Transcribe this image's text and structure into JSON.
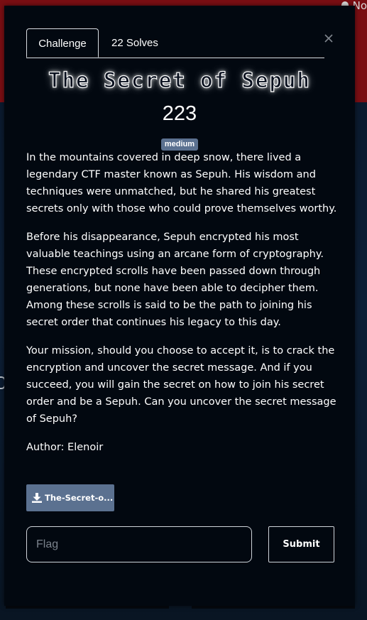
{
  "background": {
    "notification_label": "No"
  },
  "modal": {
    "tabs": [
      {
        "label": "Challenge",
        "active": true
      },
      {
        "label": "22 Solves",
        "active": false
      }
    ],
    "close_icon": "close-icon",
    "title": "The Secret of Sepuh",
    "points": "223",
    "difficulty": "medium",
    "description": [
      "In the mountains covered in deep snow, there lived a legendary CTF master known as Sepuh. His wisdom and techniques were unmatched, but he shared his greatest secrets only with those who could prove themselves worthy.",
      "Before his disappearance, Sepuh encrypted his most valuable teachings using an arcane form of cryptography. These encrypted scrolls have been passed down through generations, but none have been able to decipher them. Among these scrolls is said to be the path to joining his secret order that continues his legacy to this day.",
      "Your mission, should you choose to accept it, is to crack the encryption and uncover the secret message. And if you succeed, you will gain the secret on how to join his secret order and be a Sepuh. Can you uncover the secret message of Sepuh?"
    ],
    "author": "Author: Elenoir",
    "download": {
      "icon": "download-icon",
      "label": "The-Secret-o..."
    },
    "flag_input": {
      "placeholder": "Flag",
      "value": ""
    },
    "submit_label": "Submit"
  },
  "colors": {
    "modal_bg": "#020810",
    "badge_bg": "#5b7190",
    "topbar_bg": "#7a0e13"
  }
}
